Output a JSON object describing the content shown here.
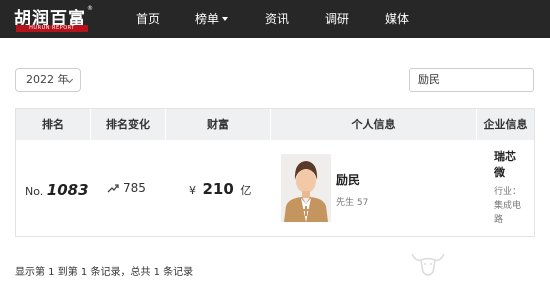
{
  "nav": {
    "logo_cn": "胡润百富",
    "logo_en": "HURUN REPORT",
    "logo_reg": "®",
    "items": [
      {
        "label": "首页"
      },
      {
        "label": "榜单"
      },
      {
        "label": "资讯"
      },
      {
        "label": "调研"
      },
      {
        "label": "媒体"
      }
    ]
  },
  "filters": {
    "year": "2022 年",
    "search_value": "励民"
  },
  "table": {
    "headers": [
      "排名",
      "排名变化",
      "财富",
      "个人信息",
      "企业信息"
    ],
    "row": {
      "rank_prefix": "No.",
      "rank": "1083",
      "rank_change": "785",
      "wealth_currency": "¥",
      "wealth_value": "210",
      "wealth_unit": "亿",
      "name": "励民",
      "meta": "先生  57",
      "company": "瑞芯微",
      "industry": "行业：集成电路"
    }
  },
  "footer": {
    "summary": "显示第 1 到第 1 条记录，总共 1 条记录"
  },
  "colors": {
    "nav_bg": "#272727",
    "logo_red": "#b5121b",
    "header_bg": "#eef0f2"
  }
}
